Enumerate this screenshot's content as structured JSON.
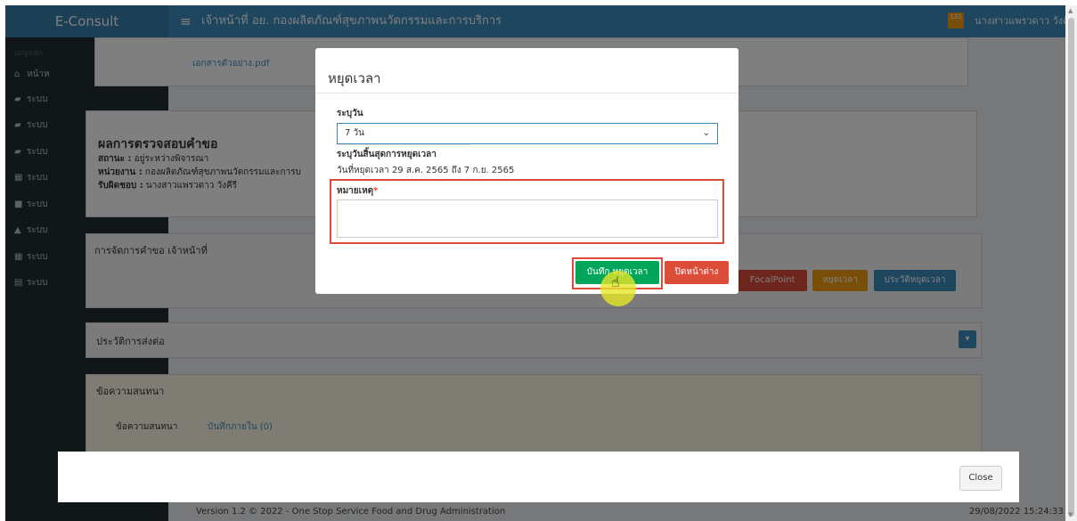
{
  "header": {
    "logo": "E-Consult",
    "menu_icon": "hamburger-icon",
    "title": "เจ้าหน้าที่ อย. กองผลิตภัณฑ์สุขภาพนวัตกรรมและการบริการ",
    "bell_count": "132",
    "user": "นางสาวแพรวดาว วังคีรี"
  },
  "sidebar": {
    "heading": "เมนูหลัก",
    "items": [
      {
        "icon": "home-icon",
        "label": "หน้าห"
      },
      {
        "icon": "file-icon",
        "label": "ระบบ"
      },
      {
        "icon": "file-icon",
        "label": "ระบบ"
      },
      {
        "icon": "file-icon",
        "label": "ระบบ"
      },
      {
        "icon": "calendar-icon",
        "label": "ระบบ"
      },
      {
        "icon": "video-icon",
        "label": "ระบบ"
      },
      {
        "icon": "graduation-icon",
        "label": "ระบบ"
      },
      {
        "icon": "calendar-icon",
        "label": "ระบบ"
      },
      {
        "icon": "document-icon",
        "label": "ระบบ"
      }
    ]
  },
  "content": {
    "attachment": "เอกสารตัวอย่าง.pdf",
    "result": {
      "title": "ผลการตรวจสอบคำขอ",
      "status_label": "สถานะ :",
      "status_value": "อยู่ระหว่างพิจารณา",
      "unit_label": "หน่วยงาน :",
      "unit_value": "กองผลิตภัณฑ์สุขภาพนวัตกรรมและการบ",
      "owner_label": "รับผิดชอบ :",
      "owner_value": "นางสาวแพรวดาว วังคีรี"
    },
    "manage_title": "การจัดการคำขอ เจ้าหน้าที่",
    "buttons": {
      "focal": "FocalPoint",
      "pause": "หยุดเวลา",
      "history_pause": "ประวัติหยุดเวลา"
    },
    "transfer_title": "ประวัติการส่งต่อ",
    "chat_title": "ข้อความสนทนา",
    "tabs": [
      "ข้อความสนทนา",
      "บันทึกภายใน (0)"
    ],
    "footer_version": "Version 1.2 © 2022 - One Stop Service Food and Drug Administration",
    "footer_date": "29/08/2022 15:24:33"
  },
  "modal": {
    "title": "หยุดเวลา",
    "period_label": "ระบุวัน",
    "period_value": "7 วัน",
    "end_label": "ระบุวันสิ้นสุดการหยุดเวลา",
    "range_text": "วันที่หยุดเวลา 29 ส.ค. 2565 ถึง 7 ก.ย. 2565",
    "reason_label": "หมายเหตุ",
    "reason_required": "*",
    "reason_value": "",
    "save_button": "บันทึก หยุดเวลา",
    "close_window_button": "ปิดหน้าต่าง"
  },
  "outer_close_button": "Close",
  "colors": {
    "header": "#3c8dbc",
    "sidebar": "#222d32",
    "save": "#00a65a",
    "danger": "#dd4b39",
    "warning": "#f39c12",
    "primary": "#3c8dbc"
  }
}
